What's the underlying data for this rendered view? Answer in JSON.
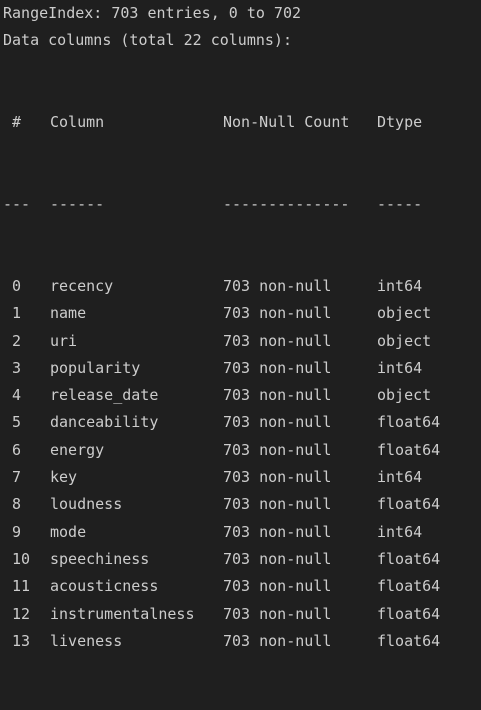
{
  "info": {
    "range_index": "RangeIndex: 703 entries, 0 to 702",
    "data_columns": "Data columns (total 22 columns):"
  },
  "header": {
    "idx": "#",
    "column": "Column",
    "non_null": "Non-Null Count",
    "dtype": "Dtype"
  },
  "separator": {
    "idx": "---",
    "column": "------",
    "non_null": "--------------",
    "dtype": "-----"
  },
  "rows": [
    {
      "idx": "0",
      "column": "recency",
      "non_null": "703 non-null",
      "dtype": "int64"
    },
    {
      "idx": "1",
      "column": "name",
      "non_null": "703 non-null",
      "dtype": "object"
    },
    {
      "idx": "2",
      "column": "uri",
      "non_null": "703 non-null",
      "dtype": "object"
    },
    {
      "idx": "3",
      "column": "popularity",
      "non_null": "703 non-null",
      "dtype": "int64"
    },
    {
      "idx": "4",
      "column": "release_date",
      "non_null": "703 non-null",
      "dtype": "object"
    },
    {
      "idx": "5",
      "column": "danceability",
      "non_null": "703 non-null",
      "dtype": "float64"
    },
    {
      "idx": "6",
      "column": "energy",
      "non_null": "703 non-null",
      "dtype": "float64"
    },
    {
      "idx": "7",
      "column": "key",
      "non_null": "703 non-null",
      "dtype": "int64"
    },
    {
      "idx": "8",
      "column": "loudness",
      "non_null": "703 non-null",
      "dtype": "float64"
    },
    {
      "idx": "9",
      "column": "mode",
      "non_null": "703 non-null",
      "dtype": "int64"
    },
    {
      "idx": "10",
      "column": "speechiness",
      "non_null": "703 non-null",
      "dtype": "float64"
    },
    {
      "idx": "11",
      "column": "acousticness",
      "non_null": "703 non-null",
      "dtype": "float64"
    },
    {
      "idx": "12",
      "column": "instrumentalness",
      "non_null": "703 non-null",
      "dtype": "float64"
    },
    {
      "idx": "13",
      "column": "liveness",
      "non_null": "703 non-null",
      "dtype": "float64"
    }
  ]
}
